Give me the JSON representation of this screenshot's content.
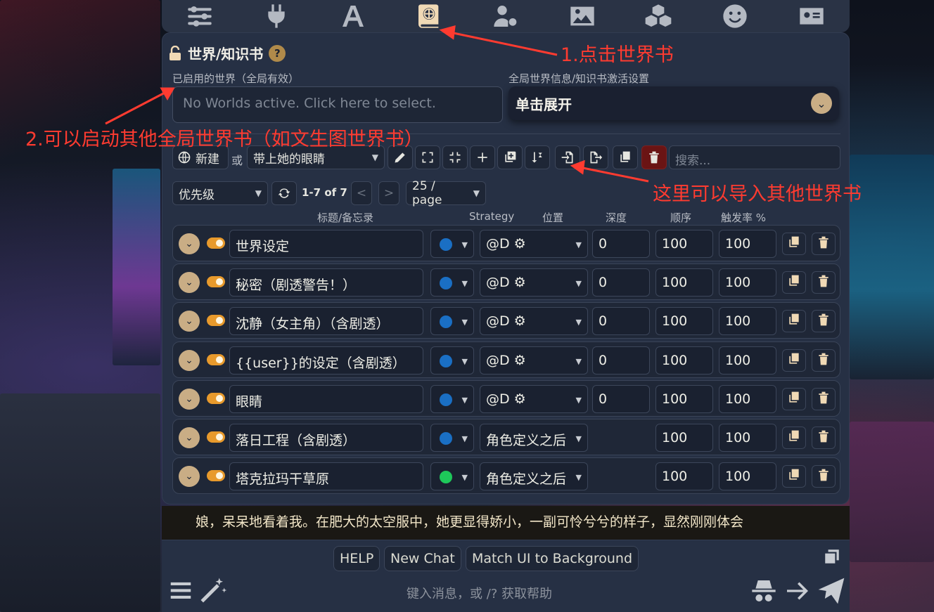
{
  "topbar": {
    "icons": [
      "sliders-icon",
      "plug-icon",
      "font-icon",
      "world-book-icon",
      "user-gear-icon",
      "image-icon",
      "cubes-icon",
      "smile-icon",
      "id-card-icon"
    ]
  },
  "panel": {
    "title": "世界/知识书",
    "help": "?",
    "active_worlds_label": "已启用的世界（全局有效）",
    "active_worlds_placeholder": "No Worlds active. Click here to select.",
    "global_settings_label": "全局世界信息/知识书激活设置",
    "expand_label": "单击展开"
  },
  "toolbar": {
    "new_label": "新建",
    "or_label": "或",
    "selected_book": "带上她的眼睛",
    "search_placeholder": "搜索..."
  },
  "pager": {
    "sort": "优先级",
    "range": "1-7 of 7",
    "prev": "<",
    "next": ">",
    "per_page": "25 / page"
  },
  "columns": {
    "title": "标题/备忘录",
    "strategy": "Strategy",
    "position": "位置",
    "depth": "深度",
    "order": "顺序",
    "probability": "触发率 %"
  },
  "entries": [
    {
      "title": "世界设定",
      "strategy_color": "#1a6fc4",
      "position": "@D ⚙",
      "depth": "0",
      "order": "100",
      "prob": "100"
    },
    {
      "title": "秘密（剧透警告！）",
      "strategy_color": "#1a6fc4",
      "position": "@D ⚙",
      "depth": "0",
      "order": "100",
      "prob": "100"
    },
    {
      "title": "沈静（女主角）（含剧透）",
      "strategy_color": "#1a6fc4",
      "position": "@D ⚙",
      "depth": "0",
      "order": "100",
      "prob": "100"
    },
    {
      "title": "{{user}}的设定（含剧透）",
      "strategy_color": "#1a6fc4",
      "position": "@D ⚙",
      "depth": "0",
      "order": "100",
      "prob": "100"
    },
    {
      "title": "眼睛",
      "strategy_color": "#1a6fc4",
      "position": "@D ⚙",
      "depth": "0",
      "order": "100",
      "prob": "100"
    },
    {
      "title": "落日工程（含剧透）",
      "strategy_color": "#1a6fc4",
      "position": "角色定义之后",
      "depth": "",
      "order": "100",
      "prob": "100"
    },
    {
      "title": "塔克拉玛干草原",
      "strategy_color": "#1ec85a",
      "position": "角色定义之后",
      "depth": "",
      "order": "100",
      "prob": "100"
    }
  ],
  "chat": {
    "line": "娘，呆呆地看着我。在肥大的太空服中，她更显得娇小，一副可怜兮兮的样子，显然刚刚体会"
  },
  "bottom": {
    "help": "HELP",
    "new_chat": "New Chat",
    "match_ui": "Match UI to Background",
    "input_placeholder": "键入消息，或 /? 获取帮助"
  },
  "annotations": {
    "a1": "1.点击世界书",
    "a2": "2.可以启动其他全局世界书（如文生图世界书）",
    "a3": "这里可以导入其他世界书",
    "color": "#ff3b30"
  }
}
